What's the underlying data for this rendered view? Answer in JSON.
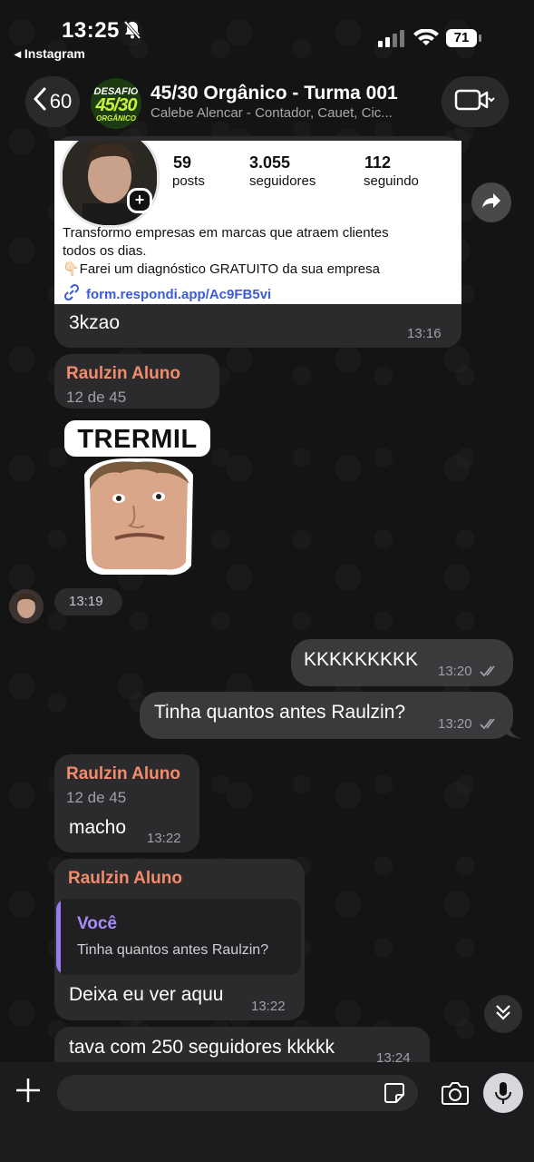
{
  "status_bar": {
    "time": "13:25",
    "back_app": "◂ Instagram",
    "battery": "71"
  },
  "header": {
    "back_count": "60",
    "title": "45/30 Orgânico - Turma 001",
    "subtitle": "Calebe Alencar - Contador, Cauet, Cic...",
    "avatar_line1": "DESAFIO",
    "avatar_line2": "45/30",
    "avatar_line3": "ORGÂNICO"
  },
  "ig_card": {
    "posts_count": "59",
    "posts_label": "posts",
    "followers_count": "3.055",
    "followers_label": "seguidores",
    "following_count": "112",
    "following_label": "seguindo",
    "bio_line1": "Transformo empresas em marcas que atraem clientes",
    "bio_line2": "todos os dias.",
    "bio_line3": "👇🏻Farei um diagnóstico GRATUITO da sua empresa",
    "link": "form.respondi.app/Ac9FB5vi"
  },
  "messages": {
    "m1": {
      "text": "3kzao",
      "time": "13:16"
    },
    "m2": {
      "sender": "Raulzin Aluno",
      "meta": "12 de 45"
    },
    "sticker": {
      "text": "TRERMIL",
      "time": "13:19"
    },
    "m3": {
      "text": "KKKKKKKKK",
      "time": "13:20"
    },
    "m4": {
      "text": "Tinha quantos antes Raulzin?",
      "time": "13:20"
    },
    "m5": {
      "sender": "Raulzin Aluno",
      "meta": "12 de 45",
      "text": "macho",
      "time": "13:22"
    },
    "m6": {
      "sender": "Raulzin Aluno",
      "reply_author": "Você",
      "reply_text": "Tinha quantos antes Raulzin?",
      "text": "Deixa eu ver aquu",
      "time": "13:22"
    },
    "m7": {
      "text": "tava com 250 seguidores kkkkk",
      "time": "13:24"
    }
  }
}
